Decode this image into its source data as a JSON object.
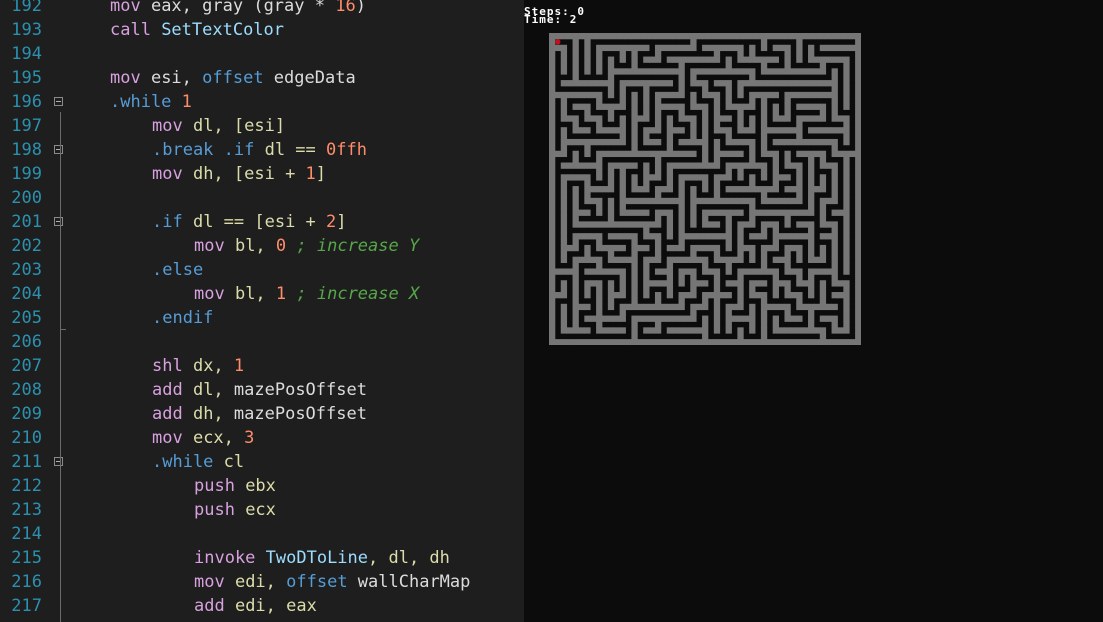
{
  "editor": {
    "lines": [
      {
        "num": "192",
        "fold": false,
        "indent": 2,
        "tokens": [
          [
            "mov",
            "t-mov"
          ],
          [
            " eax, ",
            "t-id"
          ],
          [
            "gray",
            "t-id"
          ],
          [
            " (gray * ",
            "t-id"
          ],
          [
            "16",
            "t-num"
          ],
          [
            ")",
            "t-id"
          ]
        ]
      },
      {
        "num": "193",
        "fold": false,
        "indent": 2,
        "tokens": [
          [
            "call",
            "t-mov"
          ],
          [
            " SetTextColor",
            "t-fn"
          ]
        ]
      },
      {
        "num": "194",
        "fold": false,
        "indent": 0,
        "tokens": []
      },
      {
        "num": "195",
        "fold": false,
        "indent": 2,
        "tokens": [
          [
            "mov",
            "t-mov"
          ],
          [
            " esi, ",
            "t-id"
          ],
          [
            "offset",
            "t-off"
          ],
          [
            " edgeData",
            "t-id"
          ]
        ]
      },
      {
        "num": "196",
        "fold": true,
        "indent": 2,
        "tokens": [
          [
            ".while",
            "t-dir"
          ],
          [
            " 1",
            "t-num"
          ]
        ]
      },
      {
        "num": "197",
        "fold": false,
        "indent": 4,
        "tokens": [
          [
            "mov",
            "t-mov"
          ],
          [
            " dl, [esi]",
            "t-kw"
          ]
        ]
      },
      {
        "num": "198",
        "fold": true,
        "indent": 4,
        "tokens": [
          [
            ".break .if",
            "t-dir"
          ],
          [
            " dl == ",
            "t-kw"
          ],
          [
            "0ffh",
            "t-num"
          ]
        ]
      },
      {
        "num": "199",
        "fold": false,
        "indent": 4,
        "tokens": [
          [
            "mov",
            "t-mov"
          ],
          [
            " dh, [esi + ",
            "t-kw"
          ],
          [
            "1",
            "t-num"
          ],
          [
            "]",
            "t-kw"
          ]
        ]
      },
      {
        "num": "200",
        "fold": false,
        "indent": 0,
        "tokens": []
      },
      {
        "num": "201",
        "fold": true,
        "indent": 4,
        "tokens": [
          [
            ".if",
            "t-dir"
          ],
          [
            " dl == [esi + ",
            "t-kw"
          ],
          [
            "2",
            "t-num"
          ],
          [
            "]",
            "t-kw"
          ]
        ]
      },
      {
        "num": "202",
        "fold": false,
        "indent": 6,
        "tokens": [
          [
            "mov",
            "t-mov"
          ],
          [
            " bl, ",
            "t-kw"
          ],
          [
            "0",
            "t-num"
          ],
          [
            " ; increase Y",
            "t-cmt"
          ]
        ]
      },
      {
        "num": "203",
        "fold": false,
        "indent": 4,
        "tokens": [
          [
            ".else",
            "t-dir"
          ]
        ]
      },
      {
        "num": "204",
        "fold": false,
        "indent": 6,
        "tokens": [
          [
            "mov",
            "t-mov"
          ],
          [
            " bl, ",
            "t-kw"
          ],
          [
            "1",
            "t-num"
          ],
          [
            " ; increase X",
            "t-cmt"
          ]
        ]
      },
      {
        "num": "205",
        "fold": false,
        "indent": 4,
        "tokens": [
          [
            ".endif",
            "t-dir"
          ]
        ]
      },
      {
        "num": "206",
        "fold": false,
        "indent": 0,
        "tokens": []
      },
      {
        "num": "207",
        "fold": false,
        "indent": 4,
        "tokens": [
          [
            "shl",
            "t-mov"
          ],
          [
            " dx, ",
            "t-kw"
          ],
          [
            "1",
            "t-num"
          ]
        ]
      },
      {
        "num": "208",
        "fold": false,
        "indent": 4,
        "tokens": [
          [
            "add",
            "t-mov"
          ],
          [
            " dl, ",
            "t-kw"
          ],
          [
            "mazePosOffset",
            "t-id"
          ]
        ]
      },
      {
        "num": "209",
        "fold": false,
        "indent": 4,
        "tokens": [
          [
            "add",
            "t-mov"
          ],
          [
            " dh, ",
            "t-kw"
          ],
          [
            "mazePosOffset",
            "t-id"
          ]
        ]
      },
      {
        "num": "210",
        "fold": false,
        "indent": 4,
        "tokens": [
          [
            "mov",
            "t-mov"
          ],
          [
            " ecx, ",
            "t-kw"
          ],
          [
            "3",
            "t-num"
          ]
        ]
      },
      {
        "num": "211",
        "fold": true,
        "indent": 4,
        "tokens": [
          [
            ".while",
            "t-dir"
          ],
          [
            " cl",
            "t-kw"
          ]
        ]
      },
      {
        "num": "212",
        "fold": false,
        "indent": 6,
        "tokens": [
          [
            "push",
            "t-mov"
          ],
          [
            " ebx",
            "t-kw"
          ]
        ]
      },
      {
        "num": "213",
        "fold": false,
        "indent": 6,
        "tokens": [
          [
            "push",
            "t-mov"
          ],
          [
            " ecx",
            "t-kw"
          ]
        ]
      },
      {
        "num": "214",
        "fold": false,
        "indent": 0,
        "tokens": []
      },
      {
        "num": "215",
        "fold": false,
        "indent": 6,
        "tokens": [
          [
            "invoke",
            "t-mov"
          ],
          [
            " TwoDToLine",
            "t-fn"
          ],
          [
            ", dl, dh",
            "t-kw"
          ]
        ]
      },
      {
        "num": "216",
        "fold": false,
        "indent": 6,
        "tokens": [
          [
            "mov",
            "t-mov"
          ],
          [
            " edi, ",
            "t-kw"
          ],
          [
            "offset",
            "t-off"
          ],
          [
            " wallCharMap",
            "t-id"
          ]
        ]
      },
      {
        "num": "217",
        "fold": false,
        "indent": 6,
        "tokens": [
          [
            "add",
            "t-mov"
          ],
          [
            " edi, eax",
            "t-kw"
          ]
        ]
      }
    ]
  },
  "console": {
    "steps_label": "Steps: 0",
    "time_label": "Time: 2",
    "colors": {
      "wall": "#767676",
      "path": "#0c0c0c",
      "player": "#c50f1f"
    }
  }
}
